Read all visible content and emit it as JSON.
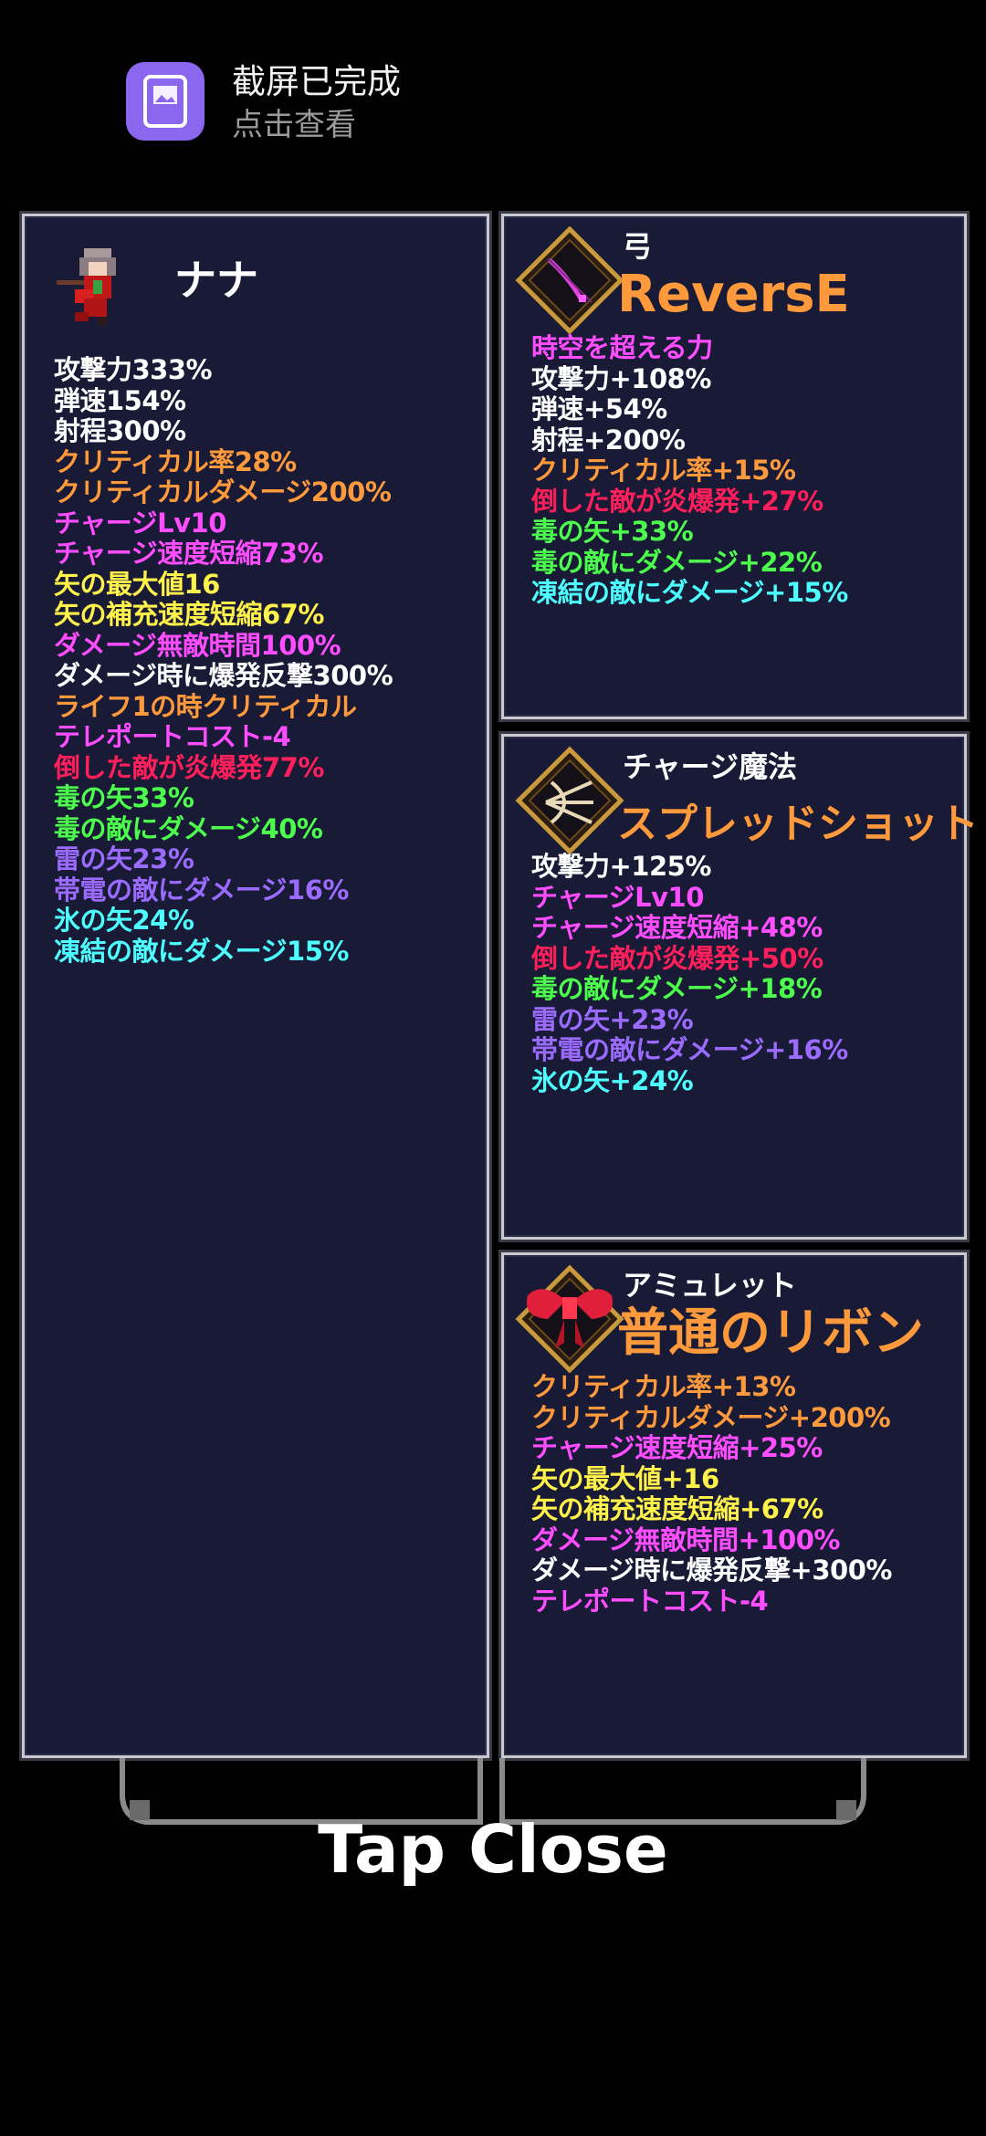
{
  "notification": {
    "title": "截屏已完成",
    "subtitle": "点击查看"
  },
  "character": {
    "name": "ナナ",
    "stats": [
      {
        "text": "攻撃力333%",
        "color": "white"
      },
      {
        "text": "弾速154%",
        "color": "white"
      },
      {
        "text": "射程300%",
        "color": "white"
      },
      {
        "text": "クリティカル率28%",
        "color": "orange"
      },
      {
        "text": "クリティカルダメージ200%",
        "color": "orange"
      },
      {
        "text": "チャージLv10",
        "color": "pink"
      },
      {
        "text": "チャージ速度短縮73%",
        "color": "pink"
      },
      {
        "text": "矢の最大値16",
        "color": "yellow"
      },
      {
        "text": "矢の補充速度短縮67%",
        "color": "yellow"
      },
      {
        "text": "ダメージ無敵時間100%",
        "color": "pink"
      },
      {
        "text": "ダメージ時に爆発反撃300%",
        "color": "white"
      },
      {
        "text": "ライフ1の時クリティカル",
        "color": "orange"
      },
      {
        "text": "テレポートコスト-4",
        "color": "pink"
      },
      {
        "text": "倒した敵が炎爆発77%",
        "color": "red"
      },
      {
        "text": "毒の矢33%",
        "color": "green"
      },
      {
        "text": "毒の敵にダメージ40%",
        "color": "green"
      },
      {
        "text": "雷の矢23%",
        "color": "purple"
      },
      {
        "text": "帯電の敵にダメージ16%",
        "color": "purple"
      },
      {
        "text": "氷の矢24%",
        "color": "cyan"
      },
      {
        "text": "凍結の敵にダメージ15%",
        "color": "cyan"
      }
    ]
  },
  "weapon": {
    "type": "弓",
    "name": "ReversE",
    "icon": "bow-icon",
    "stats": [
      {
        "text": "時空を超える力",
        "color": "pink"
      },
      {
        "text": "攻撃力+108%",
        "color": "white"
      },
      {
        "text": "弾速+54%",
        "color": "white"
      },
      {
        "text": "射程+200%",
        "color": "white"
      },
      {
        "text": "クリティカル率+15%",
        "color": "orange"
      },
      {
        "text": "倒した敵が炎爆発+27%",
        "color": "red"
      },
      {
        "text": "毒の矢+33%",
        "color": "green"
      },
      {
        "text": "毒の敵にダメージ+22%",
        "color": "green"
      },
      {
        "text": "凍結の敵にダメージ+15%",
        "color": "cyan"
      }
    ]
  },
  "charge_magic": {
    "type": "チャージ魔法",
    "name": "スプレッドショット",
    "icon": "spread-arrow-icon",
    "stats": [
      {
        "text": "攻撃力+125%",
        "color": "white"
      },
      {
        "text": "チャージLv10",
        "color": "pink"
      },
      {
        "text": "チャージ速度短縮+48%",
        "color": "pink"
      },
      {
        "text": "倒した敵が炎爆発+50%",
        "color": "red"
      },
      {
        "text": "毒の敵にダメージ+18%",
        "color": "green"
      },
      {
        "text": "雷の矢+23%",
        "color": "purple"
      },
      {
        "text": "帯電の敵にダメージ+16%",
        "color": "purple"
      },
      {
        "text": "氷の矢+24%",
        "color": "cyan"
      }
    ]
  },
  "amulet": {
    "type": "アミュレット",
    "name": "普通のリボン",
    "icon": "ribbon-icon",
    "stats": [
      {
        "text": "クリティカル率+13%",
        "color": "orange"
      },
      {
        "text": "クリティカルダメージ+200%",
        "color": "orange"
      },
      {
        "text": "チャージ速度短縮+25%",
        "color": "pink"
      },
      {
        "text": "矢の最大値+16",
        "color": "yellow"
      },
      {
        "text": "矢の補充速度短縮+67%",
        "color": "yellow"
      },
      {
        "text": "ダメージ無敵時間+100%",
        "color": "pink"
      },
      {
        "text": "ダメージ時に爆発反撃+300%",
        "color": "white"
      },
      {
        "text": "テレポートコスト-4",
        "color": "pink"
      }
    ]
  },
  "footer": {
    "close_label": "Tap Close"
  },
  "colors": {
    "white": "#ffffff",
    "orange": "#ff9a3c",
    "pink": "#ff4dff",
    "yellow": "#fff24a",
    "red": "#ff1f5a",
    "green": "#4dff4d",
    "purple": "#9b6bff",
    "cyan": "#4dffff",
    "panel_bg": "#181a36",
    "notification_icon": "#8b67f0"
  }
}
